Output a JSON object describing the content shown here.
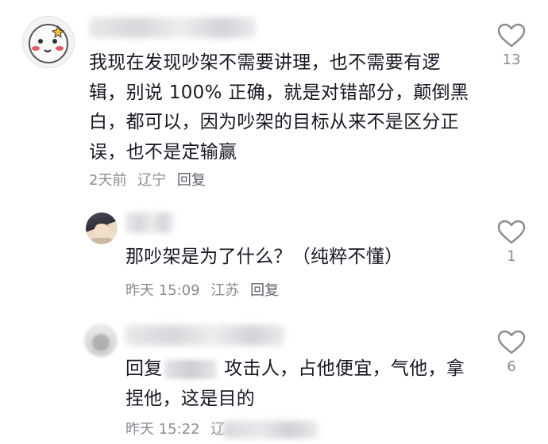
{
  "comments": [
    {
      "text": "我现在发现吵架不需要讲理，也不需要有逻辑，别说 100% 正确，就是对错部分，颠倒黑白，都可以，因为吵架的目标从来不是区分正误，也不是定输赢",
      "time": "2天前",
      "location": "辽宁",
      "reply_label": "回复",
      "likes": "13"
    }
  ],
  "replies": [
    {
      "text": "那吵架是为了什么？（纯粹不懂）",
      "time": "昨天 15:09",
      "location": "江苏",
      "reply_label": "回复",
      "likes": "1"
    },
    {
      "reply_prefix": "回复",
      "text_after": "攻击人，占他便宜，气他，拿捏他，这是目的",
      "time": "昨天 15:22",
      "location": "辽",
      "likes": "6"
    }
  ],
  "icons": {
    "like": "heart-outline-icon"
  },
  "colors": {
    "text": "#161823",
    "meta": "#8a8b91",
    "icon": "#8a8b91"
  }
}
